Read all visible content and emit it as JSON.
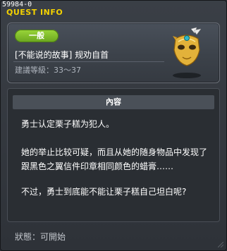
{
  "window": {
    "id_label": "59984-0",
    "title": "QUEST INFO"
  },
  "quest": {
    "category_badge": "一般",
    "name": "[不能说的故事] 规劝自首",
    "level_range": "建議等級：33～37",
    "icon": "gold-mask-icon"
  },
  "content": {
    "header": "內容",
    "paragraphs": [
      "勇士认定栗子糕为犯人。",
      "她的举止比较可疑，而且从她的随身物品中发现了",
      "跟黑色之翼信件印章相同颜色的蜡膏……",
      "不过，勇士到底能不能让栗子糕自己坦白呢?"
    ]
  },
  "status": {
    "label": "狀態：可開始"
  },
  "colors": {
    "title_yellow": "#f4d200",
    "badge_green": "#8cc832",
    "panel_bg": "#2a2e33"
  }
}
